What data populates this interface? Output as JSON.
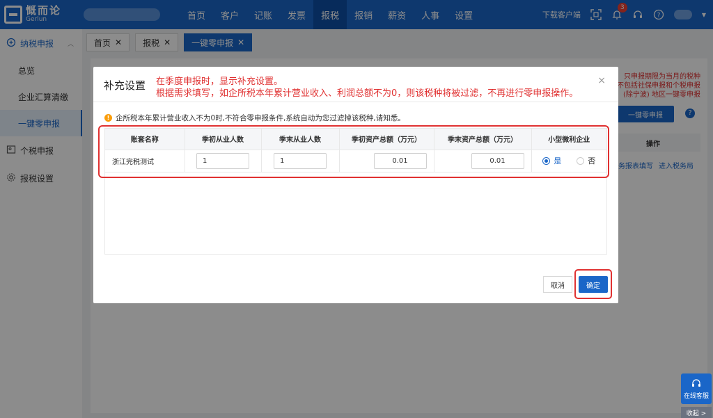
{
  "topbar": {
    "brand_cn": "慨而论",
    "brand_en": "Gerlun",
    "nav": [
      "首页",
      "客户",
      "记账",
      "发票",
      "报税",
      "报销",
      "薪资",
      "人事",
      "设置"
    ],
    "nav_active": 4,
    "download_label": "下载客户端",
    "notif_count": "3"
  },
  "sidebar": {
    "group1": "纳税申报",
    "subs": [
      "总览",
      "企业汇算清缴",
      "一键零申报"
    ],
    "group2": "个税申报",
    "group3": "报税设置"
  },
  "tabs": [
    {
      "label": "首页"
    },
    {
      "label": "报税"
    },
    {
      "label": "一键零申报"
    }
  ],
  "background": {
    "notice": "只申报期限为当月的税种\n不包括社保申报和个税申报\n(除宁波) 地区一键零申报",
    "zero_btn": "一键零申报",
    "op_header": "操作",
    "link1": "财务报表填写",
    "link2": "进入税务局"
  },
  "modal": {
    "title": "补充设置",
    "close": "×",
    "annotation_line1": "在季度申报时，显示补充设置。",
    "annotation_line2": "根据需求填写，如企所税本年累计营业收入、利润总额不为0，则该税种将被过滤，不再进行零申报操作。",
    "warning": "企所税本年累计营业收入不为0时,不符合零申报条件,系统自动为您过滤掉该税种,请知悉。",
    "columns": [
      "账套名称",
      "季初从业人数",
      "季末从业人数",
      "季初资产总额（万元）",
      "季末资产总额（万元）",
      "小型微利企业"
    ],
    "row": {
      "name": "浙江完税测试",
      "start_staff": "1",
      "end_staff": "1",
      "start_assets": "0.01",
      "end_assets": "0.01",
      "yes": "是",
      "no": "否"
    },
    "cancel": "取消",
    "ok": "确定"
  },
  "float": {
    "cs": "在线客服",
    "collapse": "收起 >"
  }
}
